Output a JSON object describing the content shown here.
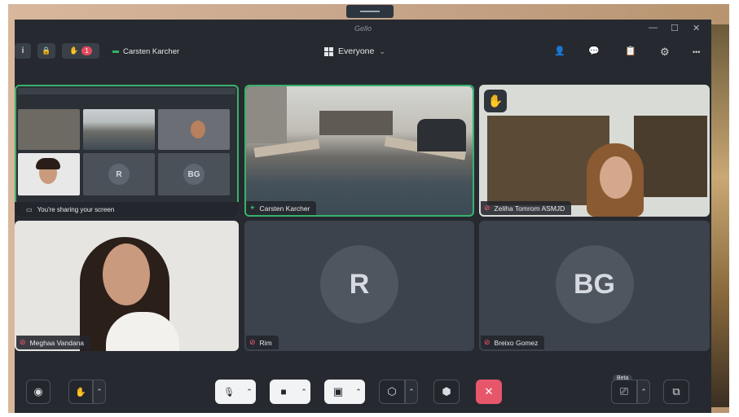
{
  "app": {
    "title": "Gello"
  },
  "window_controls": {
    "minimize": "—",
    "maximize": "☐",
    "close": "✕"
  },
  "toolbar": {
    "info_icon": "i",
    "lock_icon": "🔒",
    "hand_icon": "✋",
    "raised_hands_count": "1",
    "host_name": "Carsten Karcher",
    "view_label": "Everyone",
    "view_caret": "⌄",
    "people_icon": "👤",
    "chat_icon": "💬",
    "notes_icon": "📋",
    "settings_icon": "⚙",
    "more_icon": "•••"
  },
  "tiles": [
    {
      "name": "You're sharing your screen",
      "type": "screenshare"
    },
    {
      "name": "Carsten Karcher",
      "type": "video",
      "mic": "on"
    },
    {
      "name": "Zeliha Tomrom ASMJD",
      "type": "video",
      "mic": "off",
      "hand": "✋"
    },
    {
      "name": "Meghaa Vandana",
      "type": "video",
      "mic": "off"
    },
    {
      "name": "Rim",
      "initials": "R",
      "mic": "off"
    },
    {
      "name": "Breixo Gomez",
      "initials": "BG",
      "mic": "off"
    }
  ],
  "share_preview": {
    "mini_initials": [
      "R",
      "BG"
    ]
  },
  "controls": {
    "record_icon": "◉",
    "hand_icon": "✋",
    "mic_icon": "🎙",
    "camera_icon": "■",
    "share_icon": "▣",
    "shield_icon": "⬡",
    "apps_icon": "⬢",
    "leave_icon": "✕",
    "captions_icon": "⎚",
    "captions_badge": "Beta",
    "popout_icon": "⧉",
    "caret": "⌃"
  },
  "colors": {
    "active_speaker": "#38b26b",
    "leave_button": "#e8566b",
    "muted_mic": "#ff5d73",
    "badge": "#e24a5c"
  }
}
